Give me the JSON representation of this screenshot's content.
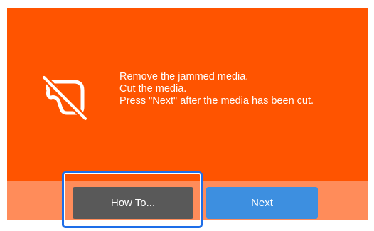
{
  "dialog": {
    "icon": "media-cut-prohibited-icon",
    "message_lines": [
      "Remove the jammed media.",
      "Cut the media.",
      "Press \"Next\" after the media has been cut."
    ]
  },
  "buttons": {
    "how_to_label": "How To...",
    "next_label": "Next"
  },
  "colors": {
    "background": "#ff5400",
    "footer": "#ff8c5a",
    "how_to_button": "#595959",
    "next_button": "#3d8fe0",
    "highlight": "#1e6ee8"
  }
}
